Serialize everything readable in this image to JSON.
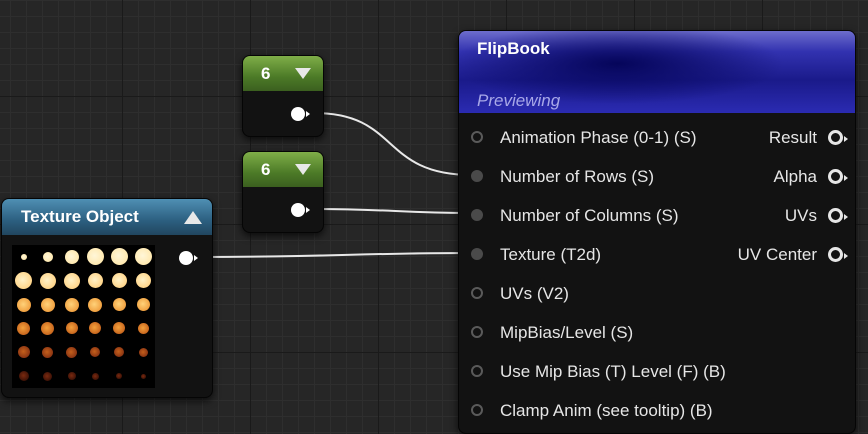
{
  "constant_nodes": [
    {
      "value": "6",
      "dropdown_icon": "triangle-down-icon"
    },
    {
      "value": "6",
      "dropdown_icon": "triangle-down-icon"
    }
  ],
  "texture_object": {
    "title": "Texture Object",
    "collapse_icon": "triangle-up-icon"
  },
  "flipbook": {
    "title": "FlipBook",
    "status": "Previewing",
    "inputs": [
      {
        "label": "Animation  Phase (0-1) (S)",
        "connected": false
      },
      {
        "label": "Number of Rows (S)",
        "connected": true
      },
      {
        "label": "Number of Columns (S)",
        "connected": true
      },
      {
        "label": "Texture (T2d)",
        "connected": true
      },
      {
        "label": "UVs (V2)",
        "connected": false
      },
      {
        "label": "MipBias/Level (S)",
        "connected": false
      },
      {
        "label": "Use Mip Bias (T) Level (F) (B)",
        "connected": false
      },
      {
        "label": "Clamp Anim (see tooltip) (B)",
        "connected": false
      }
    ],
    "outputs": [
      "Result",
      "Alpha",
      "UVs",
      "UV Center"
    ]
  },
  "colors": {
    "constant_header": "#5b8a30",
    "texture_header": "#2f6488",
    "flipbook_header": "#1e1e96",
    "wire": "#e8e8e8"
  }
}
